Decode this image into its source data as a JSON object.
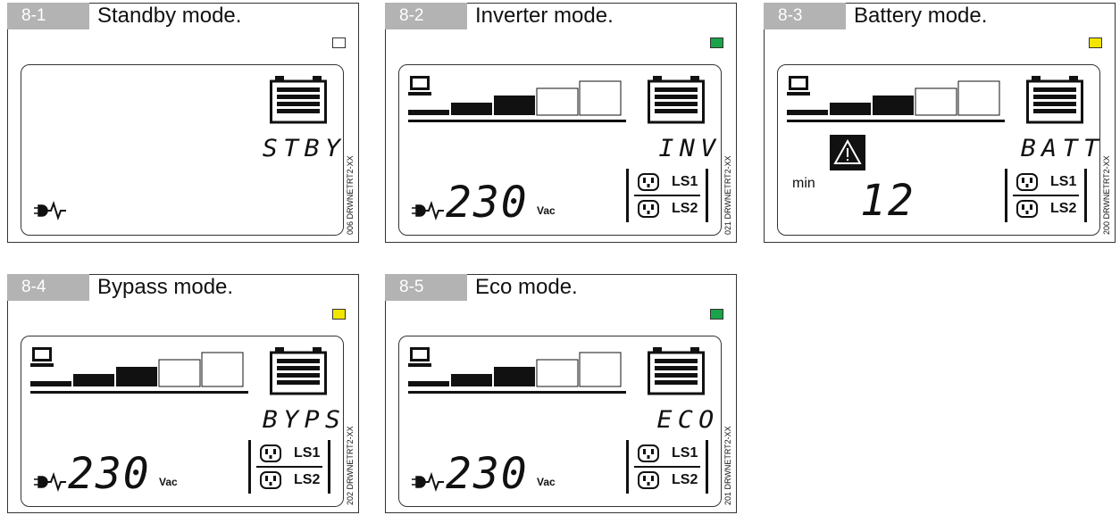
{
  "panels": [
    {
      "id": "8-1",
      "title": "Standby mode.",
      "led": "#ffffff",
      "state": "STBY",
      "code": "006 DRWNETRT2-XX"
    },
    {
      "id": "8-2",
      "title": "Inverter mode.",
      "led": "#1aa34a",
      "state": "INV",
      "voltage": "230",
      "unit": "Vac",
      "outlets": [
        "LS1",
        "LS2"
      ],
      "code": "021 DRWNETRT2-XX"
    },
    {
      "id": "8-3",
      "title": "Battery mode.",
      "led": "#f2e600",
      "state": "BATT",
      "min_label": "min",
      "minutes": "12",
      "outlets": [
        "LS1",
        "LS2"
      ],
      "code": "200 DRWNETRT2-XX"
    },
    {
      "id": "8-4",
      "title": "Bypass mode.",
      "led": "#f2e600",
      "state": "BYPS",
      "voltage": "230",
      "unit": "Vac",
      "outlets": [
        "LS1",
        "LS2"
      ],
      "code": "202 DRWNETRT2-XX"
    },
    {
      "id": "8-5",
      "title": "Eco mode.",
      "led": "#1aa34a",
      "state": "ECO",
      "voltage": "230",
      "unit": "Vac",
      "outlets": [
        "LS1",
        "LS2"
      ],
      "code": "201 DRWNETRT2-XX"
    }
  ],
  "icons": {
    "battery": "battery-icon",
    "computer": "computer-icon",
    "plug": "plug-wave-icon",
    "outlet": "outlet-icon",
    "warning": "warning-icon"
  }
}
